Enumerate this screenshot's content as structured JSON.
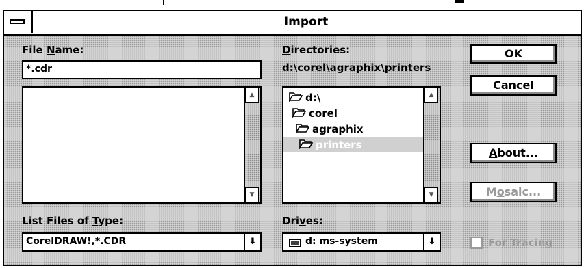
{
  "window": {
    "title": "Import"
  },
  "file_name": {
    "label_pre": "File ",
    "label_key": "N",
    "label_post": "ame:",
    "value": "*.cdr",
    "files": []
  },
  "directories": {
    "label_key": "D",
    "label_post": "irectories:",
    "current_path": "d:\\corel\\agraphix\\printers",
    "items": [
      {
        "name": "d:\\",
        "selected": false
      },
      {
        "name": "corel",
        "selected": false
      },
      {
        "name": "agraphix",
        "selected": false
      },
      {
        "name": "printers",
        "selected": true
      }
    ]
  },
  "file_type": {
    "label_pre": "List Files of ",
    "label_key": "T",
    "label_post": "ype:",
    "value": "CorelDRAW!,*.CDR"
  },
  "drives": {
    "label_pre": "Dri",
    "label_key": "v",
    "label_post": "es:",
    "value": "d: ms-system"
  },
  "buttons": {
    "ok": "OK",
    "cancel": "Cancel",
    "about_key": "A",
    "about_rest": "bout...",
    "mosaic_pre": "M",
    "mosaic_key": "o",
    "mosaic_post": "saic..."
  },
  "for_tracing": {
    "label_pre": "For T",
    "label_key": "r",
    "label_post": "acing",
    "checked": false,
    "enabled": false
  },
  "icons": {
    "system_menu": "system-menu-icon",
    "folder_open": "open-folder-icon",
    "drive": "drive-icon",
    "scroll_up": "scroll-up-arrow-icon",
    "scroll_down": "scroll-down-arrow-icon",
    "dropdown": "dropdown-arrow-icon"
  }
}
